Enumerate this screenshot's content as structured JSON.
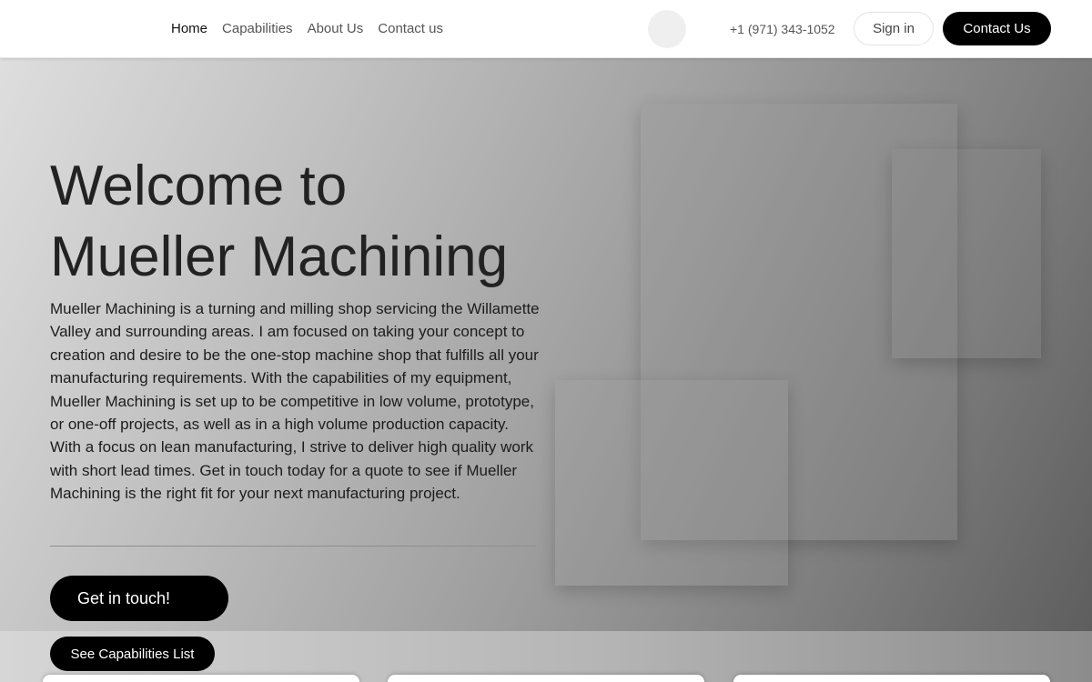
{
  "header": {
    "nav": [
      "Home",
      "Capabilities",
      "About Us",
      "Contact us"
    ],
    "phone": "+1 (971) 343-1052",
    "signin_label": "Sign in",
    "contact_label": "Contact Us"
  },
  "hero": {
    "title_line1": "Welcome to",
    "title_line2": "Mueller Machining",
    "description": "Mueller Machining is a turning and milling shop servicing the Willamette Valley and surrounding areas. I am focused on taking your concept to creation and desire to be the one-stop machine shop that fulfills all your manufacturing requirements. With the capabilities of my equipment, Mueller Machining is set up to be competitive in low volume, prototype, or one-off projects, as well as in a high volume production capacity. With a focus on lean manufacturing, I strive to deliver high quality work with short lead times. Get in touch today for a quote to see if Mueller Machining is the right fit for your next manufacturing project.",
    "cta_label": "Get in touch!"
  },
  "capabilities": {
    "button_label": "See Capabilities List"
  },
  "colors": {
    "button_bg": "#000000",
    "button_text": "#ffffff",
    "header_bg": "#ffffff"
  }
}
